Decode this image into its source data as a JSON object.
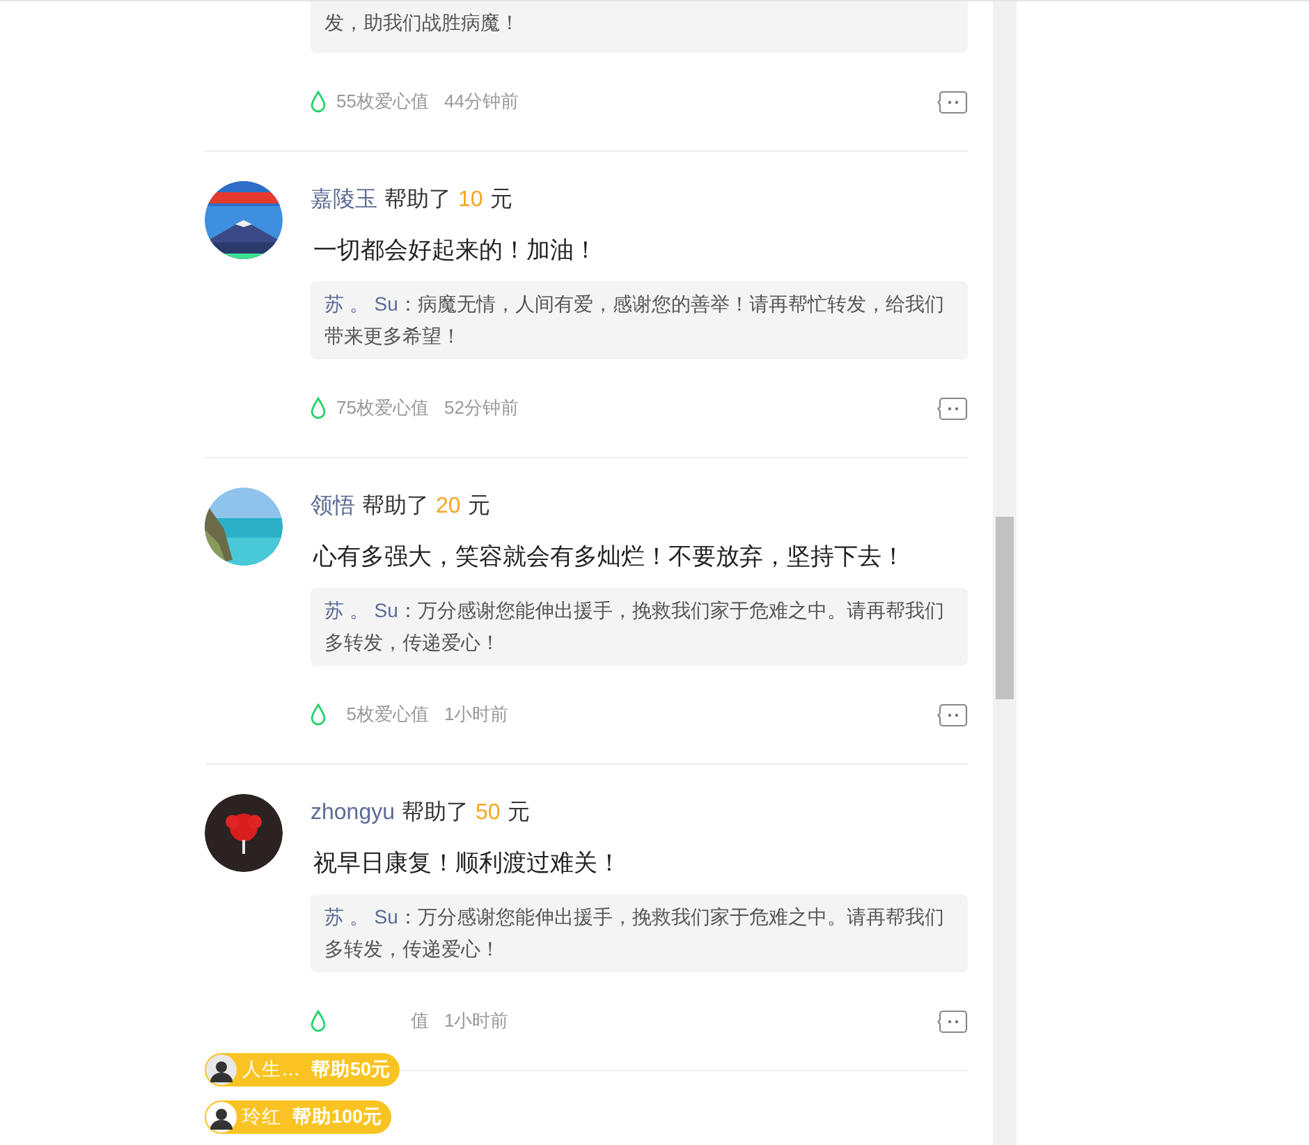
{
  "donations": [
    {
      "reply": {
        "text": "发，助我们战胜病魔！"
      },
      "love": "55枚爱心值",
      "time": "44分钟前"
    },
    {
      "user": "嘉陵玉",
      "helped": "帮助了",
      "amount": "10",
      "unit": "元",
      "message": "一切都会好起来的！加油！",
      "reply": {
        "author": "苏 。 Su",
        "text": "：病魔无情，人间有爱，感谢您的善举！请再帮忙转发，给我们带来更多希望！"
      },
      "love": "75枚爱心值",
      "time": "52分钟前"
    },
    {
      "user": "领悟",
      "helped": "帮助了",
      "amount": "20",
      "unit": "元",
      "message": "心有多强大，笑容就会有多灿烂！不要放弃，坚持下去！",
      "reply": {
        "author": "苏 。 Su",
        "text": "：万分感谢您能伸出援手，挽救我们家于危难之中。请再帮我们多转发，传递爱心！"
      },
      "love": "5枚爱心值",
      "time": "1小时前"
    },
    {
      "user": "zhongyu",
      "helped": "帮助了",
      "amount": "50",
      "unit": "元",
      "message": "祝早日康复！顺利渡过难关！",
      "reply": {
        "author": "苏 。 Su",
        "text": "：万分感谢您能伸出援手，挽救我们家于危难之中。请再帮我们多转发，传递爱心！"
      },
      "love": "值",
      "time": "1小时前"
    }
  ],
  "barrage": [
    {
      "name": "人生…",
      "amount": "帮助50元"
    },
    {
      "name": "玲红",
      "amount": "帮助100元"
    }
  ]
}
